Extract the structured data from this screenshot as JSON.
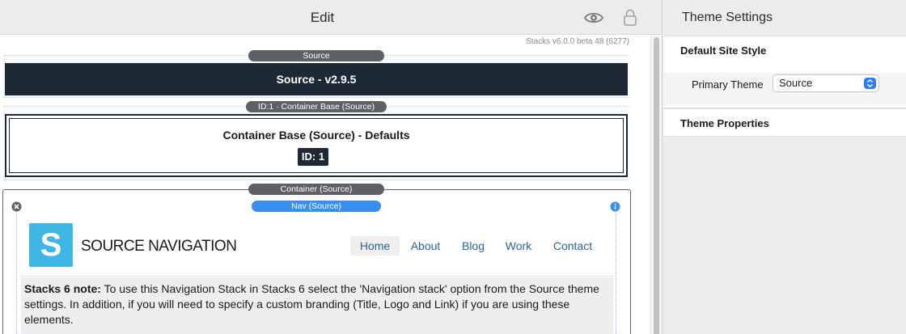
{
  "edit_pane": {
    "title": "Edit",
    "version": "Stacks v6.0.0 beta 48 (6277)",
    "icons": [
      "eye-icon",
      "lock-icon"
    ]
  },
  "stacks": {
    "source_pill": "Source",
    "source_bar": "Source - v2.9.5",
    "container_base_pill": "ID:1 · Container Base (Source)",
    "container_base_title": "Container Base (Source) - Defaults",
    "id_badge": "ID: 1",
    "container_pill": "Container (Source)",
    "nav_pill": "Nav (Source)"
  },
  "navigation": {
    "logo_letter": "S",
    "brand": "SOURCE NAVIGATION",
    "links": [
      "Home",
      "About",
      "Blog",
      "Work",
      "Contact"
    ],
    "active_link": "Home"
  },
  "note": {
    "bold": "Stacks 6 note:",
    "text": " To use this Navigation Stack in Stacks 6 select the 'Navigation stack' option from the Source theme settings. In addition, if you will need to specify a custom branding (Title, Logo and Link) if you are using these elements."
  },
  "theme_settings": {
    "title": "Theme Settings",
    "default_site_style": "Default Site Style",
    "primary_theme_label": "Primary Theme",
    "primary_theme_value": "Source",
    "theme_properties": "Theme Properties"
  },
  "colors": {
    "dark_navy": "#1d2a36",
    "pill_gray": "#5f6066",
    "pill_blue": "#3a8ef0",
    "logo_blue": "#41b6e6",
    "link_blue": "#2a6496"
  }
}
